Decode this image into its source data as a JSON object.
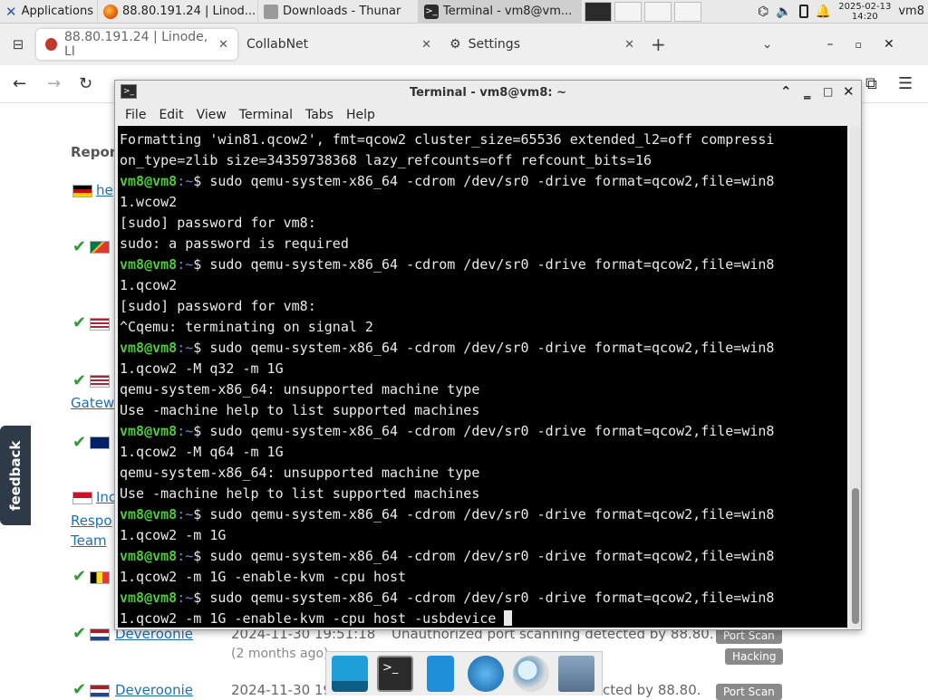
{
  "panel": {
    "applications_label": "Applications",
    "tasks": [
      {
        "label": "88.80.191.24 | Linod..."
      },
      {
        "label": "Downloads - Thunar"
      },
      {
        "label": "Terminal - vm8@vm..."
      }
    ],
    "clock_date": "2025-02-13",
    "clock_time": "14:20",
    "user": "vm8"
  },
  "browser": {
    "tabs": [
      {
        "label": "88.80.191.24 | Linode, LI"
      },
      {
        "label": "CollabNet"
      },
      {
        "label": "Settings"
      }
    ]
  },
  "webpage": {
    "feedback_label": "feedback",
    "heading_partial": "Repor",
    "links": [
      "he",
      "Gatew",
      "Inc",
      "Respo",
      "Team",
      "Deveroonie",
      "Deveroonie"
    ],
    "rows": [
      {
        "date": "2024-11-30 19:51:18",
        "ago": "(2 months ago)",
        "desc": "Unauthorized port scanning detected by 88.80.",
        "tags": [
          "Port Scan",
          "Hacking"
        ]
      },
      {
        "date": "2024-11-30 19",
        "desc": "cted by 88.80.",
        "tags": [
          "Port Scan"
        ]
      }
    ]
  },
  "terminal": {
    "title": "Terminal - vm8@vm8: ~",
    "menu": [
      "File",
      "Edit",
      "View",
      "Terminal",
      "Tabs",
      "Help"
    ],
    "prompt_user": "vm8@vm8",
    "prompt_path": ":~",
    "lines": [
      {
        "type": "out",
        "text": "Formatting 'win81.qcow2', fmt=qcow2 cluster_size=65536 extended_l2=off compressi"
      },
      {
        "type": "out",
        "text": "on_type=zlib size=34359738368 lazy_refcounts=off refcount_bits=16"
      },
      {
        "type": "cmd",
        "text": "$ sudo qemu-system-x86_64 -cdrom /dev/sr0 -drive format=qcow2,file=win8"
      },
      {
        "type": "out",
        "text": "1.wcow2"
      },
      {
        "type": "out",
        "text": "[sudo] password for vm8:"
      },
      {
        "type": "out",
        "text": "sudo: a password is required"
      },
      {
        "type": "cmd",
        "text": "$ sudo qemu-system-x86_64 -cdrom /dev/sr0 -drive format=qcow2,file=win8"
      },
      {
        "type": "out",
        "text": "1.qcow2"
      },
      {
        "type": "out",
        "text": "[sudo] password for vm8:"
      },
      {
        "type": "out",
        "text": "^Cqemu: terminating on signal 2"
      },
      {
        "type": "cmd",
        "text": "$ sudo qemu-system-x86_64 -cdrom /dev/sr0 -drive format=qcow2,file=win8"
      },
      {
        "type": "out",
        "text": "1.qcow2 -M q32 -m 1G"
      },
      {
        "type": "out",
        "text": "qemu-system-x86_64: unsupported machine type"
      },
      {
        "type": "out",
        "text": "Use -machine help to list supported machines"
      },
      {
        "type": "cmd",
        "text": "$ sudo qemu-system-x86_64 -cdrom /dev/sr0 -drive format=qcow2,file=win8"
      },
      {
        "type": "out",
        "text": "1.qcow2 -M q64 -m 1G"
      },
      {
        "type": "out",
        "text": "qemu-system-x86_64: unsupported machine type"
      },
      {
        "type": "out",
        "text": "Use -machine help to list supported machines"
      },
      {
        "type": "cmd",
        "text": "$ sudo qemu-system-x86_64 -cdrom /dev/sr0 -drive format=qcow2,file=win8"
      },
      {
        "type": "out",
        "text": "1.qcow2 -m 1G"
      },
      {
        "type": "cmd",
        "text": "$ sudo qemu-system-x86_64 -cdrom /dev/sr0 -drive format=qcow2,file=win8"
      },
      {
        "type": "out",
        "text": "1.qcow2 -m 1G -enable-kvm -cpu host"
      },
      {
        "type": "cmd",
        "text": "$ sudo qemu-system-x86_64 -cdrom /dev/sr0 -drive format=qcow2,file=win8"
      },
      {
        "type": "cur",
        "text": "1.qcow2 -m 1G -enable-kvm -cpu host -usbdevice "
      }
    ]
  },
  "colors": {
    "prompt_user": "#4dcc3a",
    "prompt_path": "#6d8fd6",
    "terminal_bg": "#000000",
    "terminal_fg": "#eaeaea"
  },
  "dock": {
    "icons": [
      "terminal-emulator-icon",
      "file-manager-icon",
      "web-browser-icon",
      "app-finder-icon",
      "folder-icon"
    ]
  }
}
